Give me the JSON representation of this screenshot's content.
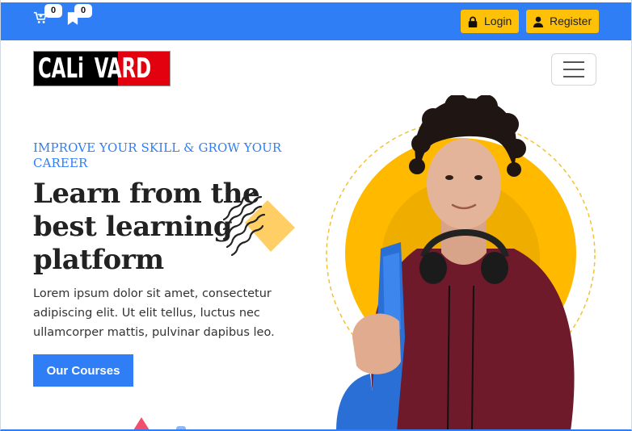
{
  "topbar": {
    "cart_count": "0",
    "wishlist_count": "0",
    "login_label": "Login",
    "register_label": "Register"
  },
  "brand": {
    "logo_left": "CALi",
    "logo_right": "VARD"
  },
  "hero": {
    "eyebrow": "IMPROVE YOUR SKILL & GROW YOUR CAREER",
    "headline_line1": "Learn from the",
    "headline_line2": "best learning",
    "headline_line3": "platform",
    "lead": "Lorem ipsum dolor sit amet, consectetur adipiscing elit. Ut elit tellus, luctus nec ullamcorper mattis, pulvinar dapibus leo.",
    "cta_label": "Our Courses"
  },
  "colors": {
    "primary": "#2f7ef5",
    "accent": "#ffc107",
    "logo_red": "#e3000f"
  },
  "icons": [
    "cart-icon",
    "bookmark-icon",
    "lock-icon",
    "user-icon",
    "menu-icon"
  ]
}
